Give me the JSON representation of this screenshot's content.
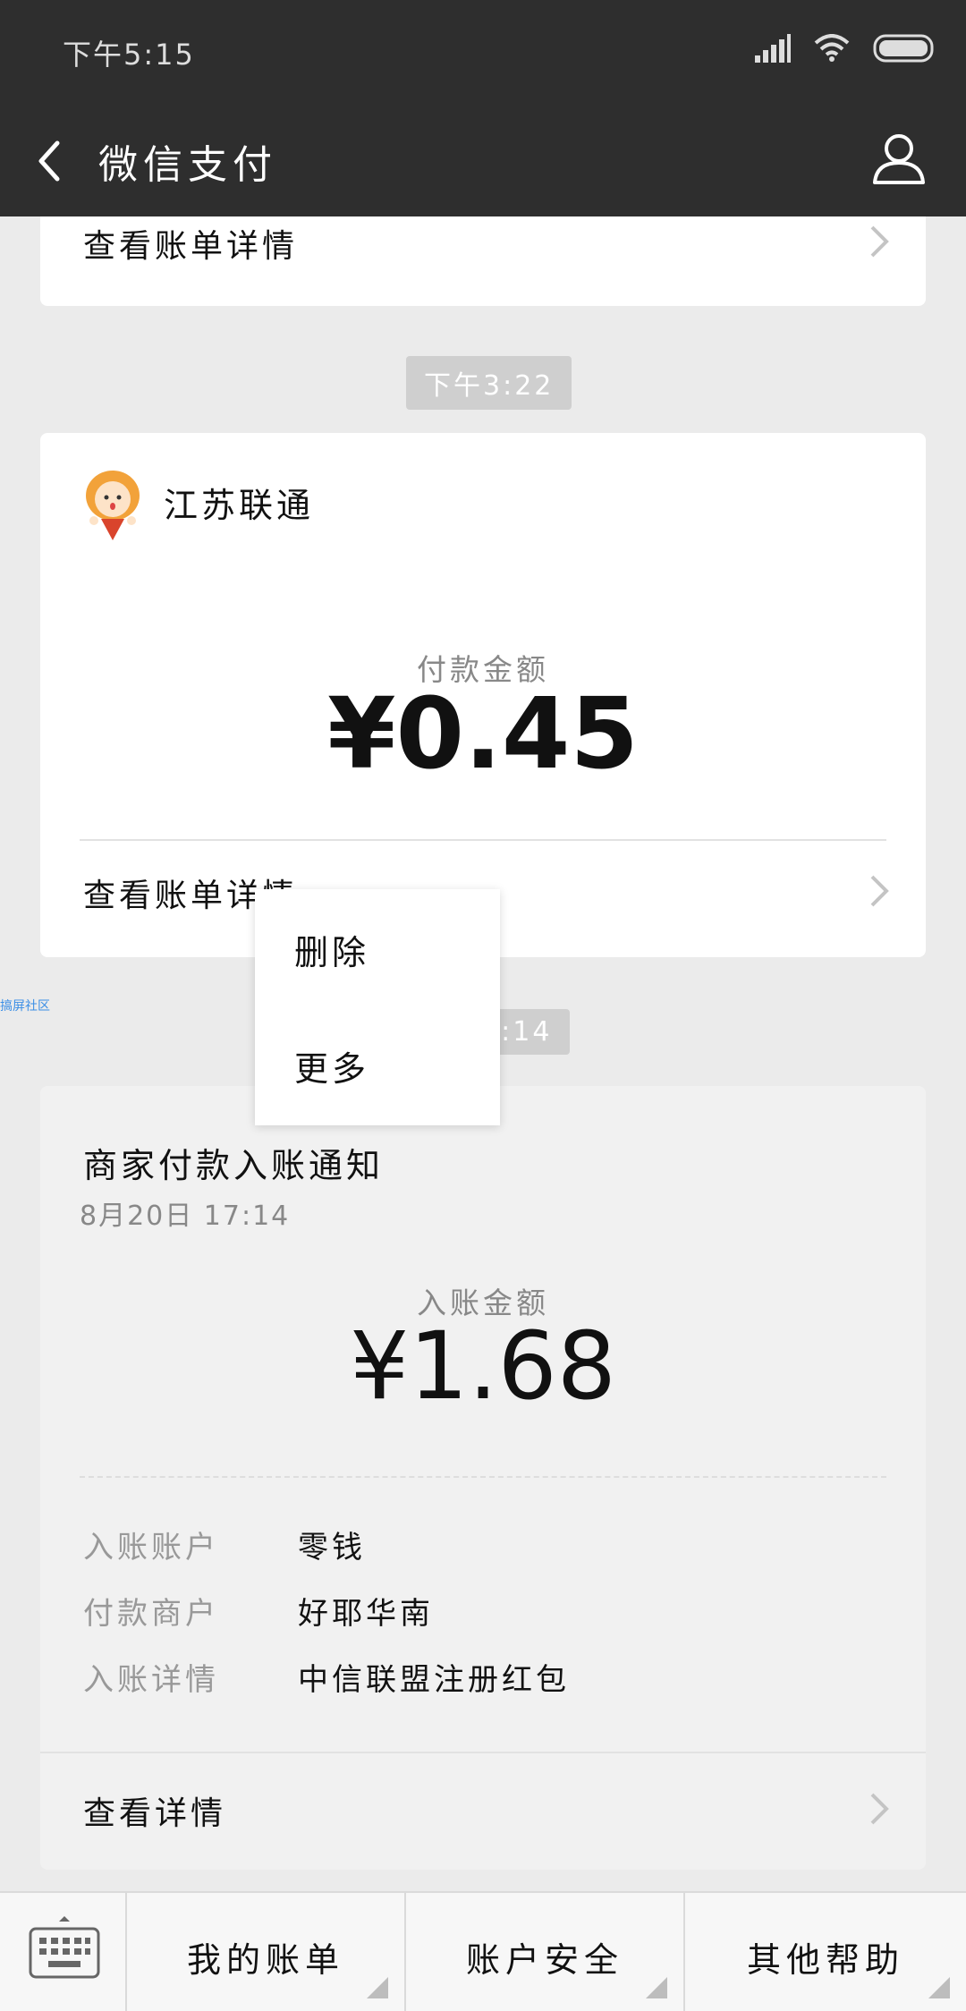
{
  "status_bar": {
    "time": "下午5:15"
  },
  "header": {
    "title": "微信支付"
  },
  "top_card": {
    "link_label": "查看账单详情"
  },
  "payment_card": {
    "time": "下午3:22",
    "merchant": "江苏联通",
    "amount_label": "付款金额",
    "amount": "¥0.45",
    "link_label": "查看账单详情"
  },
  "popup_menu": {
    "items": [
      "删除",
      "更多"
    ]
  },
  "watermark": "搞屏社区",
  "notice_card": {
    "time": "17:14",
    "title": "商家付款入账通知",
    "datetime": "8月20日 17:14",
    "amount_label": "入账金额",
    "amount": "¥1.68",
    "rows": [
      {
        "key": "入账账户",
        "value": "零钱"
      },
      {
        "key": "付款商户",
        "value": "好耶华南"
      },
      {
        "key": "入账详情",
        "value": "中信联盟注册红包"
      }
    ],
    "link_label": "查看详情"
  },
  "bottom_bar": {
    "tabs": [
      "我的账单",
      "账户安全",
      "其他帮助"
    ]
  }
}
